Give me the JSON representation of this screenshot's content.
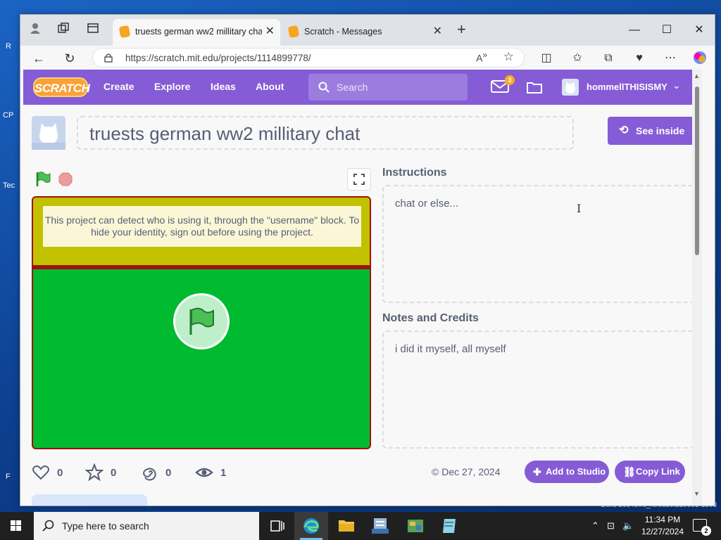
{
  "desktop": {
    "labels": [
      "R",
      "CP",
      "Tec",
      "F"
    ],
    "build_text": "Build 26348.re_release.210901-1500"
  },
  "browser": {
    "tabs": [
      {
        "title": "truests german ww2 millitary chat",
        "active": true
      },
      {
        "title": "Scratch - Messages",
        "active": false
      }
    ],
    "url": "https://scratch.mit.edu/projects/1114899778/"
  },
  "scratch": {
    "logo": "SCRATCH",
    "nav": [
      "Create",
      "Explore",
      "Ideas",
      "About"
    ],
    "search_placeholder": "Search",
    "message_count": "3",
    "username": "hommellTHISISMY",
    "project": {
      "title": "truests german ww2 millitary chat",
      "see_inside": "See inside",
      "warning": "This project can detect who is using it, through the \"username\" block. To hide your identity, sign out before using the project.",
      "instructions_label": "Instructions",
      "instructions": "chat or else...",
      "notes_label": "Notes and Credits",
      "notes": "i did it myself, all myself",
      "stats": {
        "loves": "0",
        "favorites": "0",
        "remixes": "0",
        "views": "1"
      },
      "date": "© Dec 27, 2024",
      "add_to_studio": "Add to Studio",
      "copy_link": "Copy Link"
    },
    "colors": {
      "brand": "#855cd6",
      "stage_green": "#00bb2f",
      "stage_yellow": "#c2c100"
    }
  },
  "taskbar": {
    "search_placeholder": "Type here to search",
    "time": "11:34 PM",
    "date": "12/27/2024",
    "notifications": "2"
  }
}
